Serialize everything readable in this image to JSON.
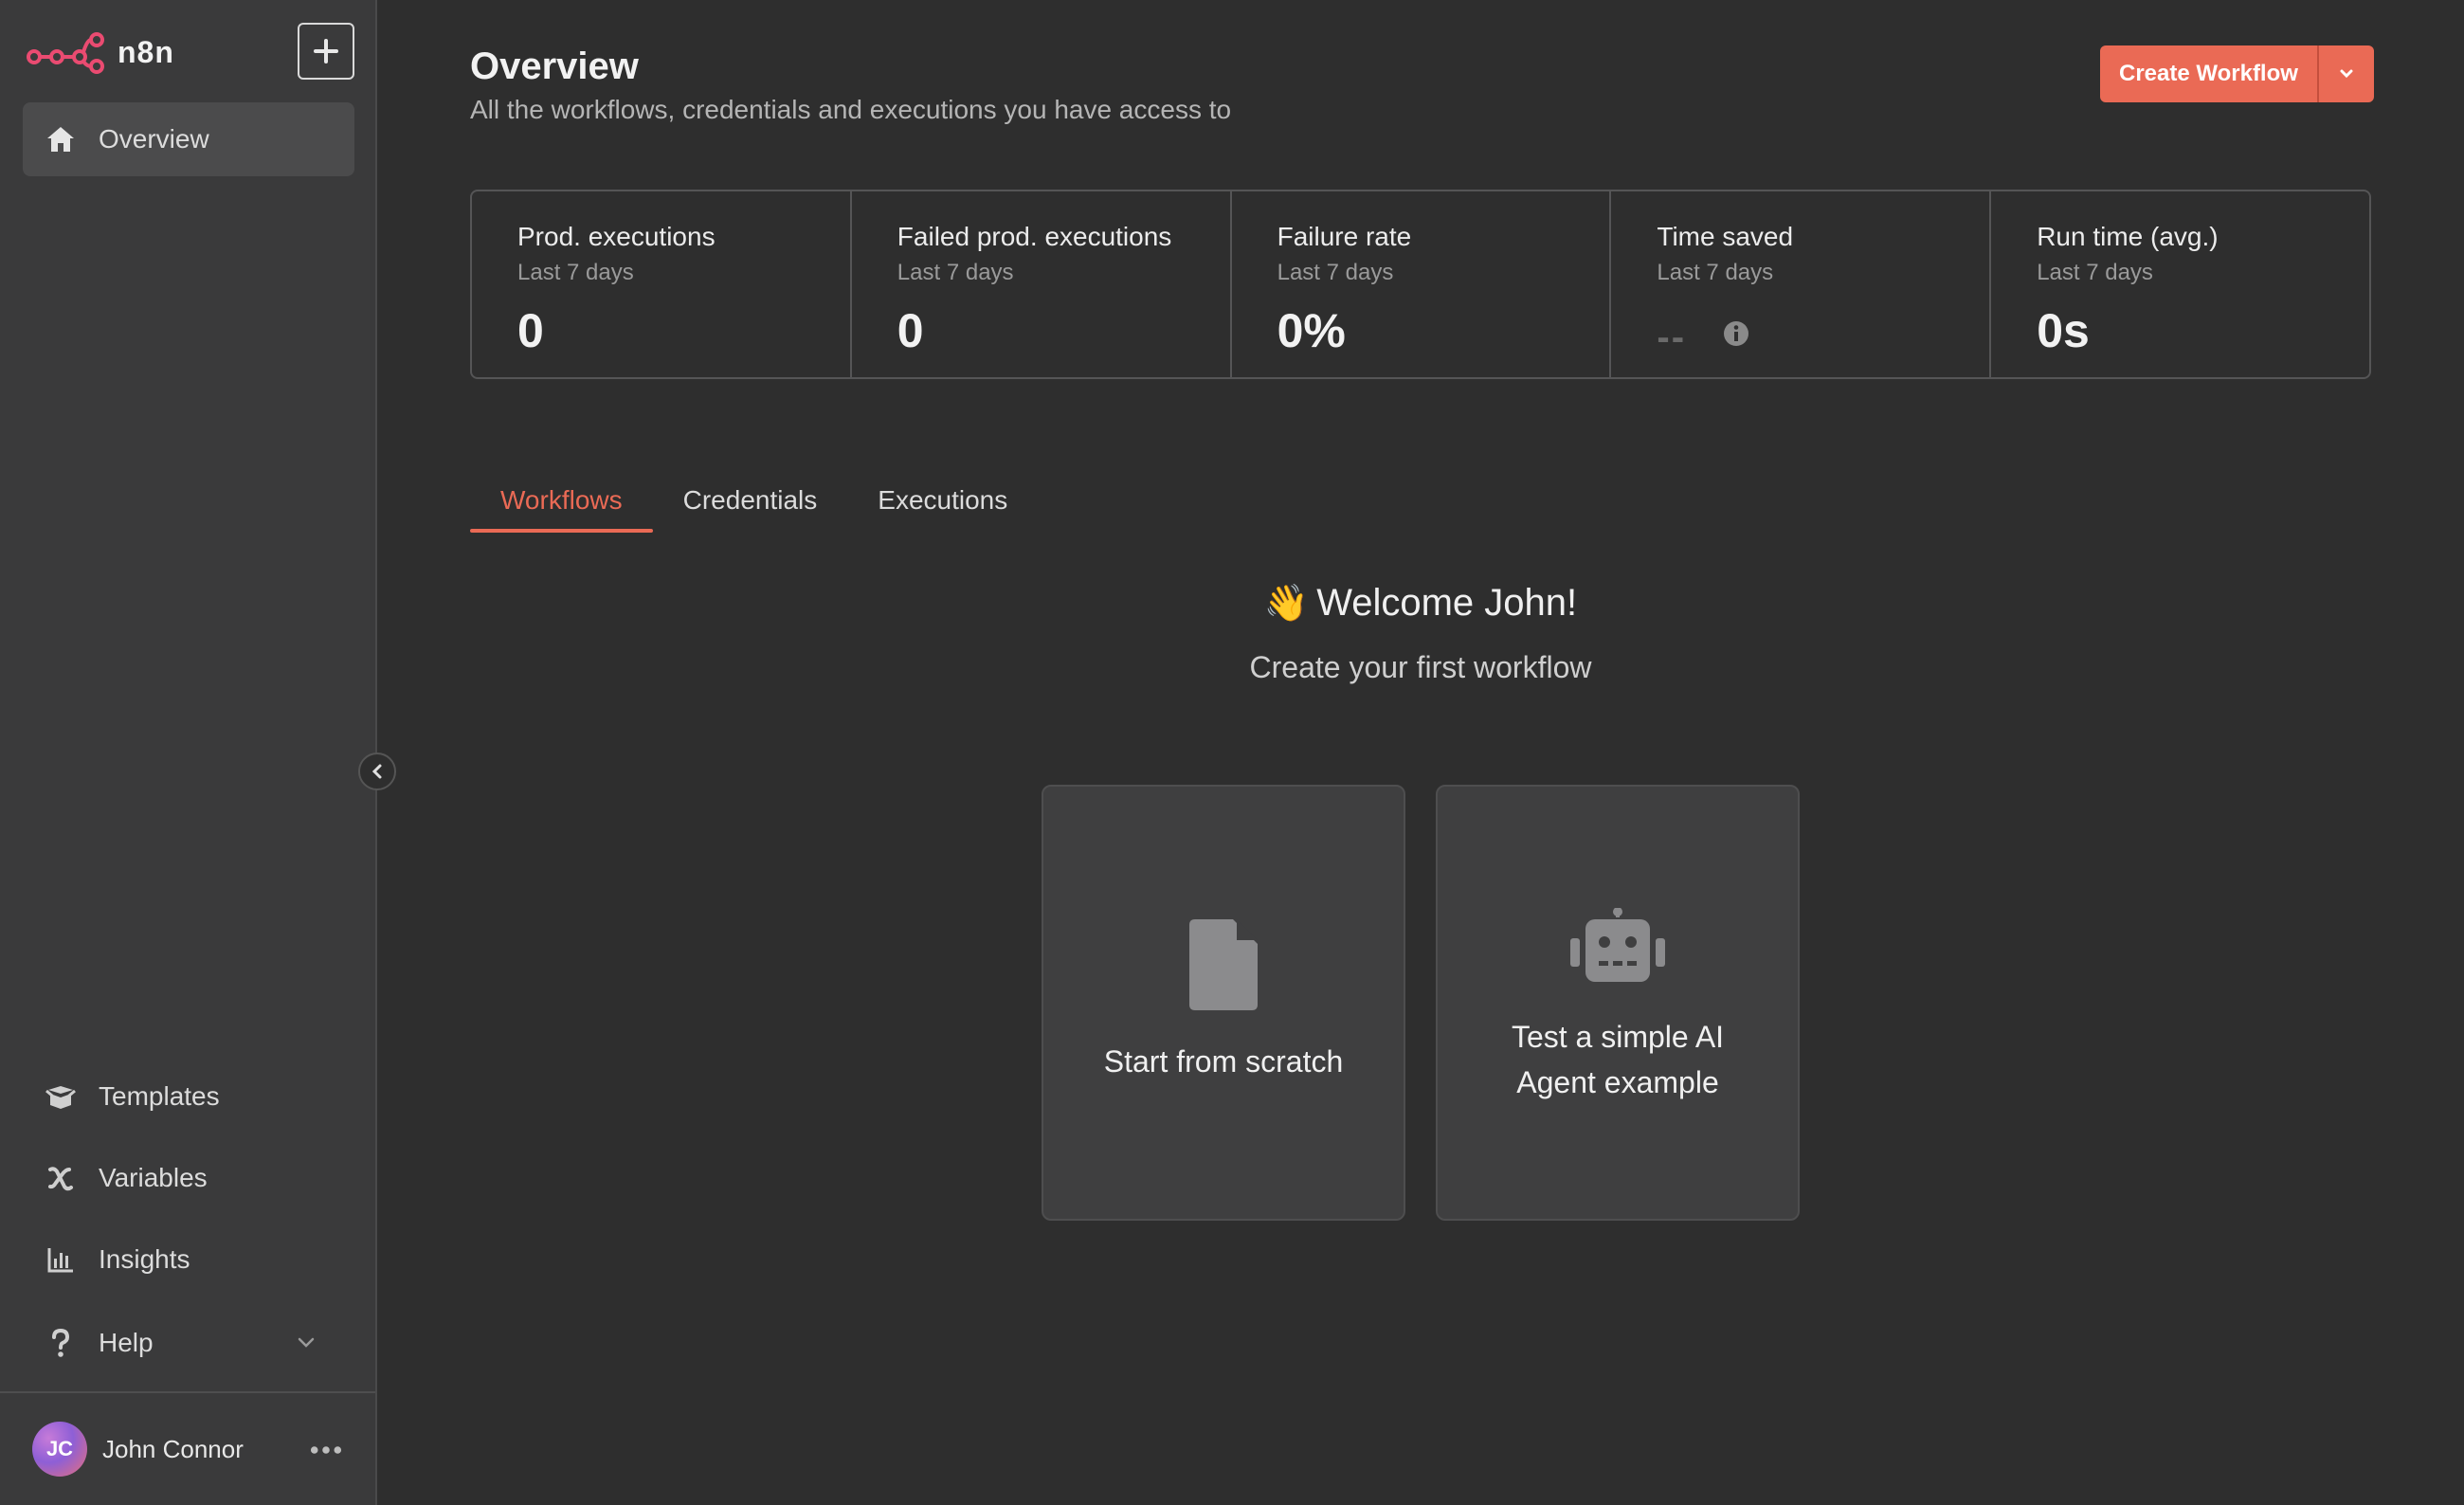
{
  "brand": {
    "name": "n8n"
  },
  "sidebar": {
    "top_items": [
      {
        "label": "Overview",
        "icon": "home-icon",
        "active": true
      }
    ],
    "bottom_items": [
      {
        "label": "Templates",
        "icon": "box-open-icon"
      },
      {
        "label": "Variables",
        "icon": "variable-icon"
      },
      {
        "label": "Insights",
        "icon": "chart-bar-icon"
      },
      {
        "label": "Help",
        "icon": "question-icon"
      }
    ],
    "user": {
      "initials": "JC",
      "name": "John Connor"
    }
  },
  "header": {
    "title": "Overview",
    "subtitle": "All the workflows, credentials and executions you have access to",
    "create_label": "Create Workflow"
  },
  "stats": [
    {
      "title": "Prod. executions",
      "sub": "Last 7 days",
      "value": "0"
    },
    {
      "title": "Failed prod. executions",
      "sub": "Last 7 days",
      "value": "0"
    },
    {
      "title": "Failure rate",
      "sub": "Last 7 days",
      "value": "0%"
    },
    {
      "title": "Time saved",
      "sub": "Last 7 days",
      "value": "--"
    },
    {
      "title": "Run time (avg.)",
      "sub": "Last 7 days",
      "value": "0s"
    }
  ],
  "tabs": [
    {
      "label": "Workflows",
      "active": true
    },
    {
      "label": "Credentials"
    },
    {
      "label": "Executions"
    }
  ],
  "welcome": {
    "emoji": "👋",
    "title": "Welcome John!",
    "subtitle": "Create your first workflow"
  },
  "cards": [
    {
      "label": "Start from scratch",
      "icon": "file-icon"
    },
    {
      "label_line1": "Test a simple AI",
      "label_line2": "Agent example",
      "icon": "robot-icon"
    }
  ],
  "colors": {
    "accent": "#ea6a55",
    "brand": "#ea4b71",
    "background": "#2e2e2e",
    "sidebar": "#3a3a3b"
  }
}
